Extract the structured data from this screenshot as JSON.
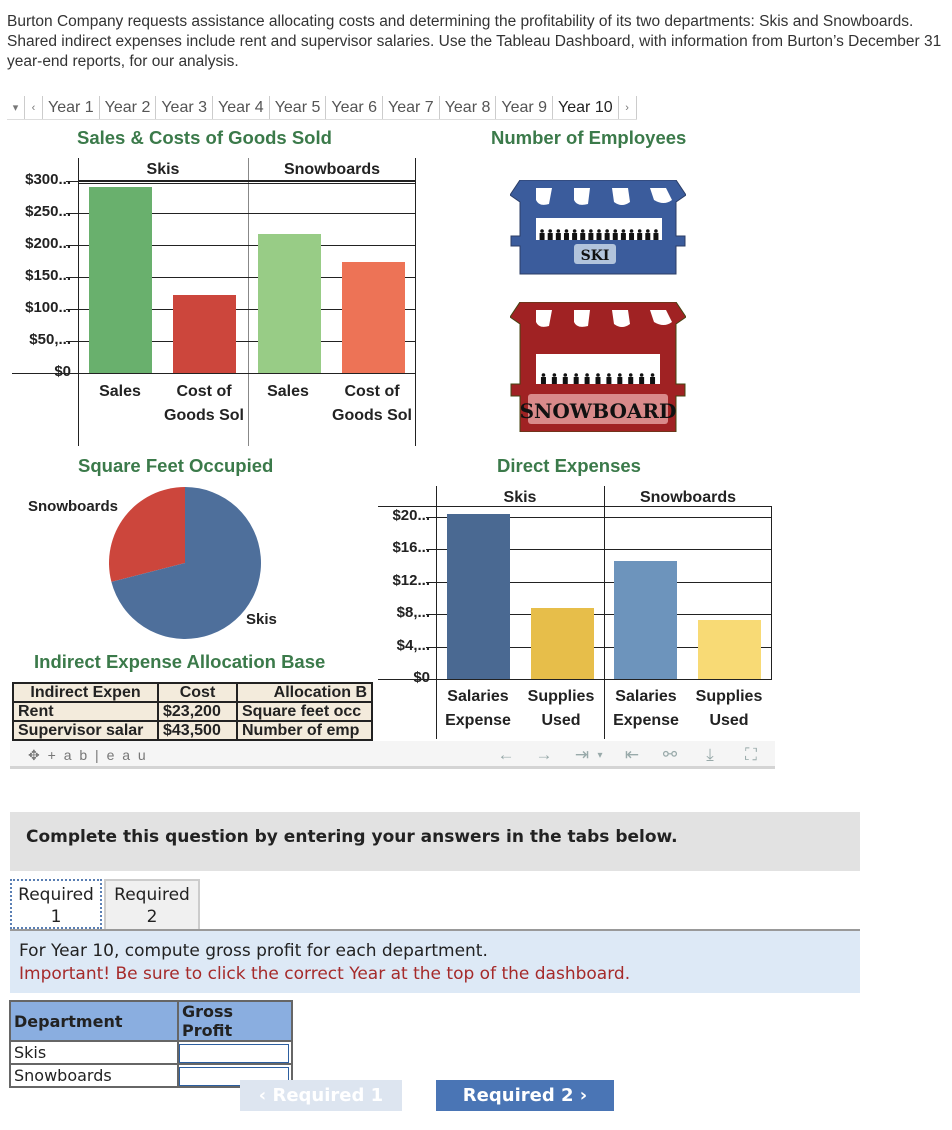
{
  "intro": "Burton Company requests assistance allocating costs and determining the profitability of its two departments: Skis and Snowboards. Shared indirect expenses include rent and supervisor salaries. Use the Tableau Dashboard, with information from Burton’s December 31 year-end reports, for our analysis.",
  "year_bar": {
    "dropdown_icon": "▾",
    "prev_icon": "‹",
    "next_icon": "›",
    "years": [
      "Year 1",
      "Year 2",
      "Year 3",
      "Year 4",
      "Year 5",
      "Year 6",
      "Year 7",
      "Year 8",
      "Year 9",
      "Year 10"
    ],
    "selected": "Year 10"
  },
  "chart_data": [
    {
      "type": "bar",
      "title": "Sales & Costs of Goods Sold",
      "groups": [
        "Skis",
        "Snowboards"
      ],
      "categories": [
        "Sales",
        "Cost of Goods Sol"
      ],
      "series": [
        {
          "group": "Skis",
          "category": "Sales",
          "value": 290000,
          "color": "#69b06d"
        },
        {
          "group": "Skis",
          "category": "Cost of Goods Sold",
          "value": 122000,
          "color": "#cc463c"
        },
        {
          "group": "Snowboards",
          "category": "Sales",
          "value": 217000,
          "color": "#98cc86"
        },
        {
          "group": "Snowboards",
          "category": "Cost of Goods Sold",
          "value": 173000,
          "color": "#ed7356"
        }
      ],
      "yticks": [
        "$0",
        "$50,...",
        "$100...",
        "$150...",
        "$200...",
        "$250...",
        "$300..."
      ],
      "ytick_values": [
        0,
        50000,
        100000,
        150000,
        200000,
        250000,
        300000
      ],
      "ylim": [
        0,
        300000
      ],
      "grid": true
    },
    {
      "type": "pie",
      "title": "Square Feet Occupied",
      "labels": [
        "Snowboards",
        "Skis"
      ],
      "values": [
        29,
        71
      ],
      "colors": [
        "#cc463c",
        "#4e6f9b"
      ]
    },
    {
      "type": "bar",
      "title": "Direct Expenses",
      "groups": [
        "Skis",
        "Snowboards"
      ],
      "categories": [
        "Salaries Expense",
        "Supplies Used"
      ],
      "series": [
        {
          "group": "Skis",
          "category": "Salaries Expense",
          "value": 20400,
          "color": "#4a6992"
        },
        {
          "group": "Skis",
          "category": "Supplies Used",
          "value": 8800,
          "color": "#e7be4a"
        },
        {
          "group": "Snowboards",
          "category": "Salaries Expense",
          "value": 14600,
          "color": "#6d94bc"
        },
        {
          "group": "Snowboards",
          "category": "Supplies Used",
          "value": 7300,
          "color": "#f8da75"
        }
      ],
      "yticks": [
        "$0",
        "$4,...",
        "$8,...",
        "$12...",
        "$16...",
        "$20..."
      ],
      "ytick_values": [
        0,
        4000,
        8000,
        12000,
        16000,
        20000
      ],
      "ylim": [
        0,
        20000
      ],
      "grid": true
    }
  ],
  "employees": {
    "title": "Number of Employees",
    "ski_label": "SKI",
    "ski_count_icons": 15,
    "snowboard_label": "SNOWBOARD",
    "snowboard_count_icons": 11
  },
  "allocation": {
    "title": "Indirect Expense Allocation Base",
    "headers": [
      "Indirect Expen",
      "Cost",
      "Allocation B"
    ],
    "rows": [
      [
        "Rent",
        "$23,200",
        "Square feet occ"
      ],
      [
        "Supervisor salar",
        "$43,500",
        "Number of emp"
      ]
    ]
  },
  "tableau_footer": {
    "logo": "+ a b | e a u",
    "icons": [
      "undo-icon",
      "redo-icon",
      "revert-icon",
      "reset-icon",
      "share-icon",
      "download-icon",
      "fullscreen-icon"
    ]
  },
  "question": {
    "banner": "Complete this question by entering your answers in the tabs below.",
    "tabs": [
      {
        "line1": "Required",
        "line2": "1"
      },
      {
        "line1": "Required",
        "line2": "2"
      }
    ],
    "instruction": "For Year 10, compute gross profit for each department.",
    "important": "Important! Be sure to click the correct Year at the top of the dashboard.",
    "answer_table": {
      "headers": [
        "Department",
        "Gross Profit"
      ],
      "rows": [
        {
          "department": "Skis",
          "value": ""
        },
        {
          "department": "Snowboards",
          "value": ""
        }
      ]
    },
    "prev_button": "‹  Required 1",
    "next_button": "Required 2  ›"
  }
}
